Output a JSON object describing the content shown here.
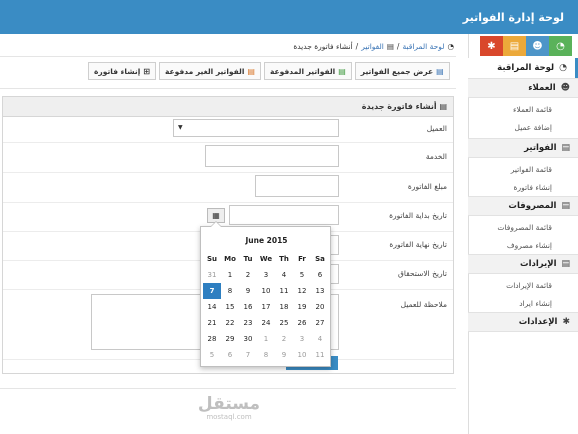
{
  "header": {
    "title": "لوحة إدارة الفواتير"
  },
  "breadcrumb": {
    "items": [
      "لوحة المراقبة",
      "الفواتير",
      "أنشاء فاتورة جديدة"
    ],
    "separator": "/"
  },
  "toolbar": {
    "all_invoices": "عرض جميع الفواتير",
    "paid": "الفواتير المدفوعة",
    "unpaid": "الفواتير الغير مدفوعة",
    "create": "إنشاء فاتورة"
  },
  "sidebar": {
    "dashboard": "لوحة المراقبة",
    "clients": "العملاء",
    "client_list": "قائمة العملاء",
    "add_client": "إضافة عميل",
    "invoices": "الفواتير",
    "invoice_list": "قائمة الفواتير",
    "create_invoice": "إنشاء فاتورة",
    "expenses": "المصروفات",
    "expense_list": "قائمة المصروفات",
    "create_expense": "إنشاء مصروف",
    "revenues": "الإيرادات",
    "revenue_list": "قائمة الإيرادات",
    "create_revenue": "إنشاء ايراد",
    "settings": "الإعدادات"
  },
  "form": {
    "title": "أنشاء فاتورة جديدة",
    "client_label": "العميل",
    "service_label": "الخدمة",
    "amount_label": "مبلغ الفاتورة",
    "start_label": "تاريخ بداية الفاتورة",
    "end_label": "تاريخ نهاية الفاتورة",
    "due_label": "تاريخ الاستحقاق",
    "note_label": "ملاحظة للعميل"
  },
  "datepicker": {
    "month": "June 2015",
    "weekdays": [
      "Su",
      "Mo",
      "Tu",
      "We",
      "Th",
      "Fr",
      "Sa"
    ],
    "weeks": [
      [
        "31",
        "1",
        "2",
        "3",
        "4",
        "5",
        "6"
      ],
      [
        "7",
        "8",
        "9",
        "10",
        "11",
        "12",
        "13"
      ],
      [
        "14",
        "15",
        "16",
        "17",
        "18",
        "19",
        "20"
      ],
      [
        "21",
        "22",
        "23",
        "24",
        "25",
        "26",
        "27"
      ],
      [
        "28",
        "29",
        "30",
        "1",
        "2",
        "3",
        "4"
      ],
      [
        "5",
        "6",
        "7",
        "8",
        "9",
        "10",
        "11"
      ]
    ],
    "selected": "7"
  },
  "watermark": {
    "arabic": "مستقل",
    "latin": "mostaql.com"
  },
  "colors": {
    "topbar": "#3a8cc4",
    "tile_red": "#d9472b",
    "tile_yellow": "#eca93a",
    "tile_blue": "#4d95c8",
    "tile_green": "#5ab25a",
    "selected_day": "#2e7fc1"
  }
}
